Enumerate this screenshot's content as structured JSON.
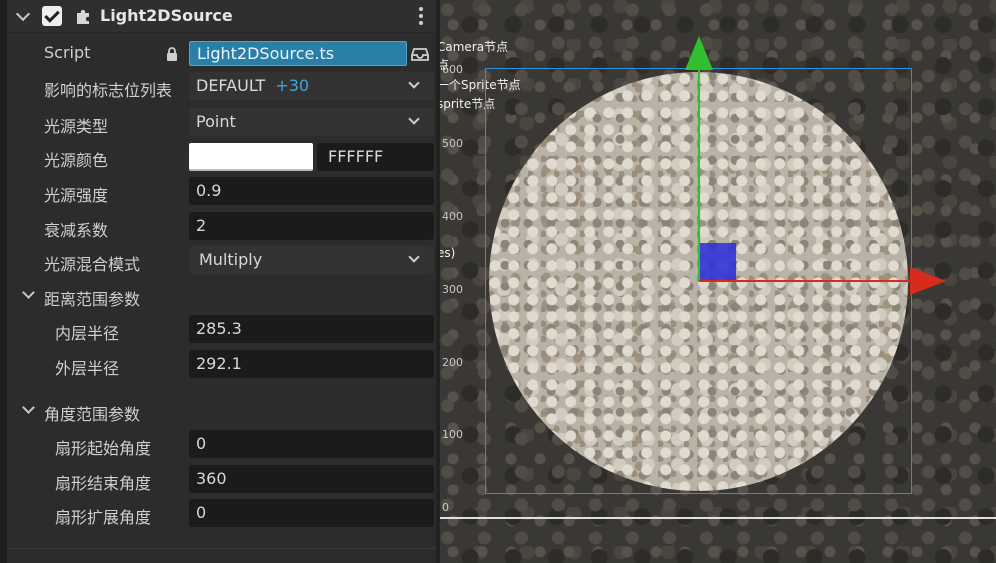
{
  "component": {
    "title": "Light2DSource"
  },
  "properties": {
    "script_label": "Script",
    "script_value": "Light2DSource.ts",
    "flags_label": "影响的标志位列表",
    "flags_value": "DEFAULT",
    "flags_extra": "+30",
    "light_type_label": "光源类型",
    "light_type_value": "Point",
    "light_color_label": "光源颜色",
    "light_color_swatch": "#FFFFFF",
    "light_color_hex": "FFFFFF",
    "intensity_label": "光源强度",
    "intensity_value": "0.9",
    "falloff_label": "衰减系数",
    "falloff_value": "2",
    "blend_label": "光源混合模式",
    "blend_value": "Multiply"
  },
  "distance_section": {
    "title": "距离范围参数",
    "inner_label": "内层半径",
    "inner_value": "285.3",
    "outer_label": "外层半径",
    "outer_value": "292.1"
  },
  "angle_section": {
    "title": "角度范围参数",
    "start_label": "扇形起始角度",
    "start_value": "0",
    "end_label": "扇形结束角度",
    "end_value": "360",
    "spread_label": "扇形扩展角度",
    "spread_value": "0"
  },
  "scene": {
    "ruler_ticks": [
      "600",
      "500",
      "400",
      "300",
      "200",
      "100",
      "0"
    ],
    "hierarchy_texts": [
      "Camera节点",
      "点",
      "一个Sprite节点",
      "sprite节点",
      "es)"
    ],
    "colors": {
      "gizmo_x": "#d92a1e",
      "gizmo_y": "#2fbf2f",
      "gizmo_center": "#3232d8",
      "selection": "#2f8fd8"
    }
  }
}
